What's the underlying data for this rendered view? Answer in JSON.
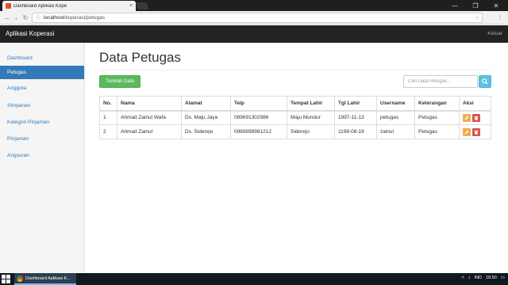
{
  "browser": {
    "tab_title": "Dashboard Aplikasi Kope",
    "tab_close": "×",
    "url_host": "localhost",
    "url_path": "/koperasi/petugas",
    "win_min": "—",
    "win_max": "❐",
    "win_close": "✕"
  },
  "navbar": {
    "brand": "Aplikasi Koperasi",
    "logout": "Keluar"
  },
  "sidebar": {
    "items": [
      {
        "label": "Dashboard"
      },
      {
        "label": "Petugas"
      },
      {
        "label": "Anggota"
      },
      {
        "label": "Simpanan"
      },
      {
        "label": "Kategori Pinjaman"
      },
      {
        "label": "Pinjaman"
      },
      {
        "label": "Angsuran"
      }
    ]
  },
  "main": {
    "title": "Data Petugas",
    "add_button": "Tambah Data",
    "search_placeholder": "Cari Data Petugas..."
  },
  "table": {
    "headers": [
      "No.",
      "Nama",
      "Alamat",
      "Telp",
      "Tempat Lahir",
      "Tgl Lahir",
      "Username",
      "Keterangan",
      "Aksi"
    ],
    "rows": [
      [
        "1",
        "Ahmad Zainul Wafa",
        "Ds. Maju Jaya",
        "089691302986",
        "Maju Mundur",
        "1997-11-13",
        "petugas",
        "Petugas"
      ],
      [
        "2",
        "Ahmad Zainul",
        "Ds. Siderejo",
        "0989898981212",
        "Siderejo",
        "1198-08-19",
        "zainul",
        "Petugas"
      ]
    ]
  },
  "taskbar": {
    "app_label": "Dashboard Aplikasi K...",
    "lang": "IND",
    "time": "18.50"
  },
  "colors": {
    "primary": "#337ab7",
    "success": "#5cb85c",
    "info": "#5bc0de",
    "warning": "#f0ad4e",
    "danger": "#d9534f",
    "navbar": "#222222"
  },
  "icons": {
    "edit": "pencil-icon",
    "delete": "trash-icon",
    "search": "search-icon"
  }
}
